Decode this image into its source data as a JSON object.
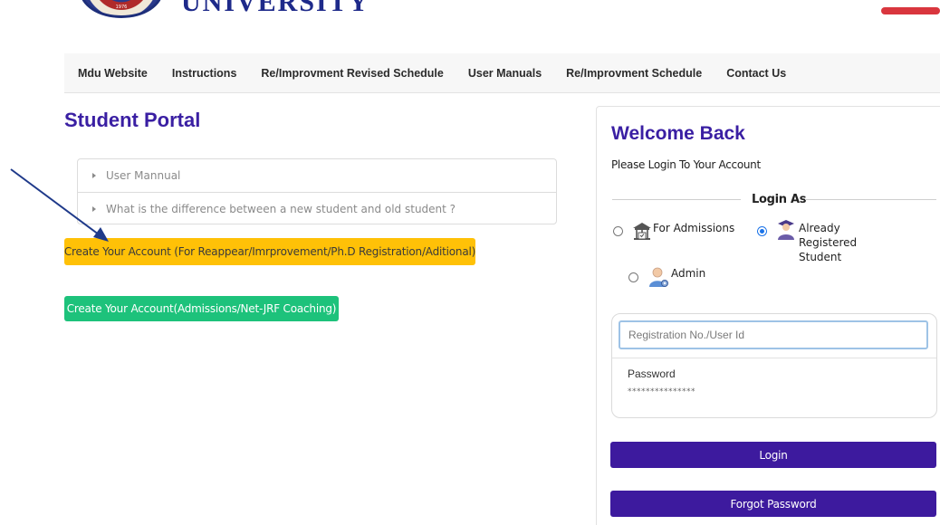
{
  "header": {
    "university_name": "UNIVERSITY",
    "logo_year": "1976"
  },
  "nav": {
    "items": [
      {
        "label": "Mdu Website"
      },
      {
        "label": "Instructions"
      },
      {
        "label": "Re/Improvment Revised Schedule"
      },
      {
        "label": "User Manuals"
      },
      {
        "label": "Re/Improvment Schedule"
      },
      {
        "label": "Contact Us"
      }
    ]
  },
  "portal": {
    "title": "Student Portal",
    "accordion": [
      {
        "label": "User Mannual"
      },
      {
        "label": "What is the difference between a new student and old student ?"
      }
    ],
    "create_account_reappear": "Create Your Account (For Reappear/Imrprovement/Ph.D Registration/Aditional)",
    "create_account_admissions": "Create Your Account(Admissions/Net-JRF Coaching)"
  },
  "login": {
    "title": "Welcome Back",
    "subtitle": "Please Login To Your Account",
    "login_as": "Login As",
    "options": {
      "admissions": "For Admissions",
      "registered": "Already Registered Student",
      "admin": "Admin"
    },
    "selected_option": "registered",
    "user_placeholder": "Registration No./User Id",
    "password_label": "Password",
    "password_value": "***************",
    "login_button": "Login",
    "forgot_button": "Forgot Password"
  },
  "colors": {
    "accent_purple": "#3d1a9e",
    "title_purple": "#3a1fa3",
    "warning_yellow": "#ffc107",
    "success_green": "#1dc27b",
    "arrow_blue": "#1f3a8a"
  }
}
